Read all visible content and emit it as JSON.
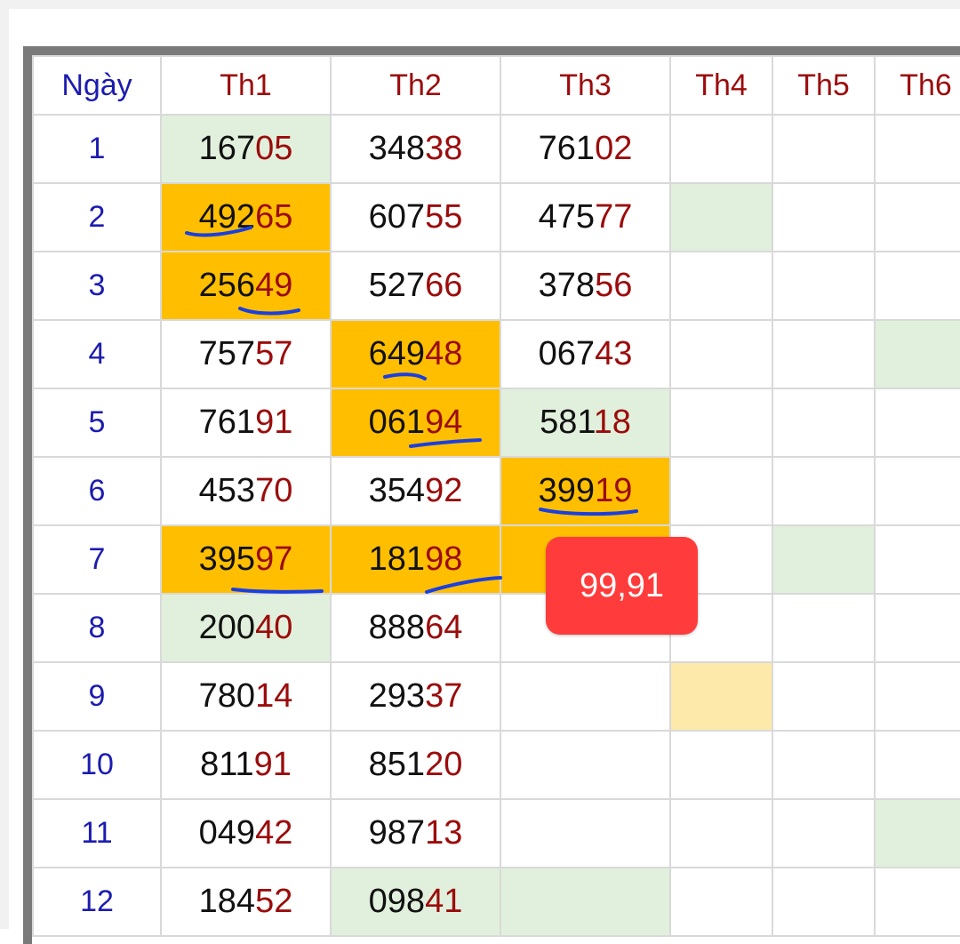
{
  "header": {
    "day_label": "Ngày",
    "weekdays": [
      "Th1",
      "Th2",
      "Th3",
      "Th4",
      "Th5",
      "Th6"
    ]
  },
  "rows": [
    {
      "day": "1",
      "cells": [
        {
          "head": "167",
          "tail": "05"
        },
        {
          "head": "348",
          "tail": "38"
        },
        {
          "head": "761",
          "tail": "02"
        }
      ]
    },
    {
      "day": "2",
      "cells": [
        {
          "head": "492",
          "tail": "65"
        },
        {
          "head": "607",
          "tail": "55"
        },
        {
          "head": "475",
          "tail": "77"
        }
      ]
    },
    {
      "day": "3",
      "cells": [
        {
          "head": "256",
          "tail": "49"
        },
        {
          "head": "527",
          "tail": "66"
        },
        {
          "head": "378",
          "tail": "56"
        }
      ]
    },
    {
      "day": "4",
      "cells": [
        {
          "head": "757",
          "tail": "57"
        },
        {
          "head": "649",
          "tail": "48"
        },
        {
          "head": "067",
          "tail": "43"
        }
      ]
    },
    {
      "day": "5",
      "cells": [
        {
          "head": "761",
          "tail": "91"
        },
        {
          "head": "061",
          "tail": "94"
        },
        {
          "head": "581",
          "tail": "18"
        }
      ]
    },
    {
      "day": "6",
      "cells": [
        {
          "head": "453",
          "tail": "70"
        },
        {
          "head": "354",
          "tail": "92"
        },
        {
          "head": "399",
          "tail": "19"
        }
      ]
    },
    {
      "day": "7",
      "cells": [
        {
          "head": "395",
          "tail": "97"
        },
        {
          "head": "181",
          "tail": "98"
        }
      ]
    },
    {
      "day": "8",
      "cells": [
        {
          "head": "200",
          "tail": "40"
        },
        {
          "head": "888",
          "tail": "64"
        }
      ]
    },
    {
      "day": "9",
      "cells": [
        {
          "head": "780",
          "tail": "14"
        },
        {
          "head": "293",
          "tail": "37"
        }
      ]
    },
    {
      "day": "10",
      "cells": [
        {
          "head": "811",
          "tail": "91"
        },
        {
          "head": "851",
          "tail": "20"
        }
      ]
    },
    {
      "day": "11",
      "cells": [
        {
          "head": "049",
          "tail": "42"
        },
        {
          "head": "987",
          "tail": "13"
        }
      ]
    },
    {
      "day": "12",
      "cells": [
        {
          "head": "184",
          "tail": "52"
        },
        {
          "head": "098",
          "tail": "41"
        }
      ]
    }
  ],
  "badge": {
    "text": "99,91"
  },
  "colors": {
    "day_text": "#1c1cb0",
    "header_text": "#9b0c0c",
    "tail_text": "#9b0c0c",
    "highlight_orange": "#ffbf00",
    "highlight_green": "#e1f0dc",
    "highlight_pale": "#fde9a9",
    "badge_bg": "#ff3b3b",
    "annotation_ink": "#1a3fe0"
  }
}
